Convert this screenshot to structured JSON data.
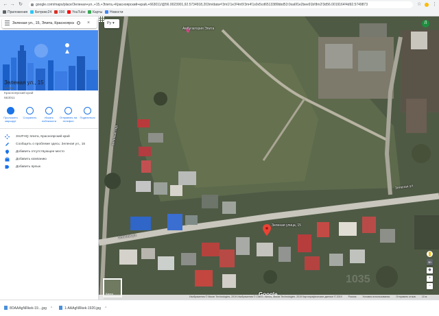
{
  "browser": {
    "url": "google.com/maps/place/Зеленая+ул.,+15,+Элита,+Красноярский+край,+663011/@56.0023901,92.5734918,203m/data=!3m1!1e3!4m5!3m4!1s0x5cd6513389bbd53:0xa6f1e2bee91b!8m2!3d56.0019164!4d92.5749873",
    "bookmarks": [
      {
        "label": "Приложения",
        "icon": "apps-icon"
      },
      {
        "label": "Битрикс24",
        "icon": "bitrix-icon",
        "color": "#2fc6f6"
      },
      {
        "label": "000",
        "icon": "bookmark-icon",
        "color": "#d93025"
      },
      {
        "label": "YouTube",
        "icon": "youtube-icon",
        "color": "#ff0000"
      },
      {
        "label": "Карты",
        "icon": "maps-icon",
        "color": "#34a853"
      },
      {
        "label": "Новости",
        "icon": "news-icon",
        "color": "#4285f4"
      }
    ]
  },
  "panel": {
    "search_value": "Зеленая ул., 15, Элита, Красноярский",
    "title": "Зеленая ул., 15",
    "address_lines": [
      "Элита",
      "Красноярский край",
      "663011"
    ],
    "actions": [
      {
        "label": "Проложить маршрут",
        "icon": "directions-icon"
      },
      {
        "label": "Сохранить",
        "icon": "save-icon"
      },
      {
        "label": "Искать поблизости",
        "icon": "nearby-icon"
      },
      {
        "label": "Отправить на телефон",
        "icon": "send-to-phone-icon"
      },
      {
        "label": "Поделиться",
        "icon": "share-icon"
      }
    ],
    "info_rows": [
      {
        "text": "3HJFHQ Элита, Красноярский край",
        "icon": "plus-code-icon"
      },
      {
        "text": "Сообщить о проблеме здесь: Зеленая ул., 15",
        "icon": "pencil-icon"
      },
      {
        "text": "Добавить отсутствующее место",
        "icon": "add-place-icon"
      },
      {
        "text": "Добавить компанию",
        "icon": "business-icon"
      },
      {
        "text": "Добавить ярлык",
        "icon": "label-icon"
      }
    ]
  },
  "map": {
    "lang": "Ру",
    "avatar_letter": "Л",
    "labels": {
      "pin_label": "Зеленая улица, 15",
      "poi": "Амбулатория Элита",
      "street_top": "Зеленая ул.",
      "street_left": "Зеленая ул.",
      "street_vertical": "Зеленый пер."
    },
    "layers_label": "Карта",
    "google": "Google",
    "watermark": "1035",
    "footer": [
      "Изображения © Maxar Technologies, 2019 Изображения © CNES / Airbus, Maxar Technologies. 2019 Картографические данные © 2019",
      "Россия",
      "Условия использования",
      "Отправить отзыв",
      "10 м"
    ],
    "pin_color": "#ea4335"
  },
  "downloads": [
    {
      "name": "8OAAAgNRkek-19....jpg"
    },
    {
      "name": "1-AAAgNRkek-1920.jpg"
    }
  ]
}
